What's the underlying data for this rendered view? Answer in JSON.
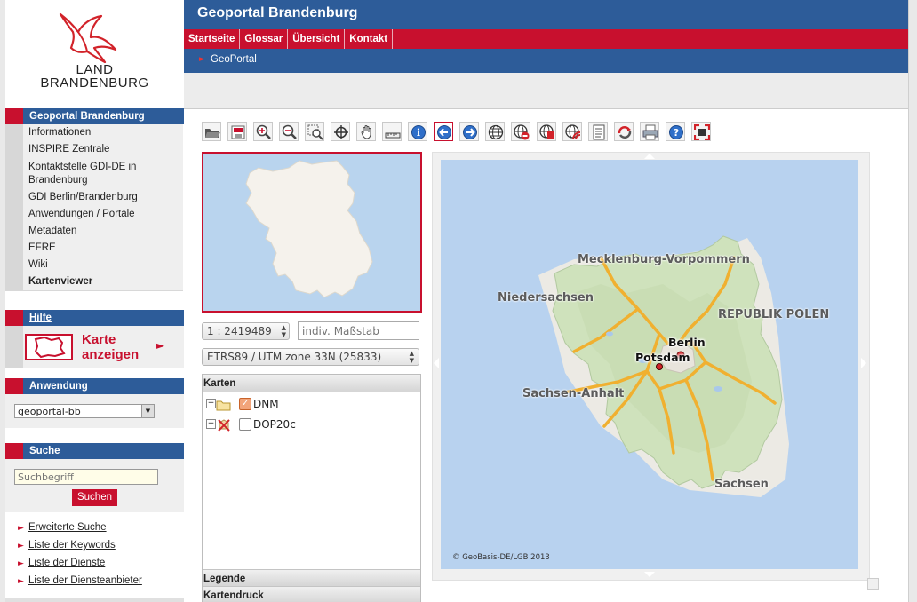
{
  "logo": {
    "line1": "LAND",
    "line2": "BRANDENBURG"
  },
  "header": {
    "title": "Geoportal Brandenburg"
  },
  "topnav": [
    "Startseite",
    "Glossar",
    "Übersicht",
    "Kontakt"
  ],
  "breadcrumb": "GeoPortal",
  "sidebar": {
    "section_title": "Geoportal Brandenburg",
    "items": [
      {
        "label": "Informationen"
      },
      {
        "label": "INSPIRE Zentrale"
      },
      {
        "label": "Kontaktstelle GDI-DE in Brandenburg"
      },
      {
        "label": "GDI Berlin/Brandenburg"
      },
      {
        "label": "Anwendungen / Portale"
      },
      {
        "label": "Metadaten"
      },
      {
        "label": "EFRE"
      },
      {
        "label": "Wiki"
      },
      {
        "label": "Kartenviewer"
      }
    ],
    "help_title": "Hilfe",
    "show_map_line1": "Karte",
    "show_map_line2": "anzeigen",
    "app_title": "Anwendung",
    "app_select": "geoportal-bb",
    "search_title": "Suche",
    "search_placeholder": "Suchbegriff",
    "search_button": "Suchen",
    "links": [
      "Erweiterte Suche",
      "Liste der Keywords",
      "Liste der Dienste",
      "Liste der Diensteanbieter"
    ]
  },
  "toolbar_icons": [
    "open-folder-icon",
    "save-icon",
    "zoom-in-icon",
    "zoom-out-icon",
    "zoom-box-icon",
    "center-icon",
    "pan-hand-icon",
    "measure-icon",
    "info-icon",
    "back-icon",
    "forward-icon",
    "globe-icon",
    "globe-remove-icon",
    "globe-add-icon",
    "globe-feed-icon",
    "layer-list-icon",
    "refresh-icon",
    "print-icon",
    "help-icon",
    "fullscreen-icon"
  ],
  "scale": {
    "value": "1 : 2419489",
    "custom_placeholder": "indiv. Maßstab"
  },
  "crs": "ETRS89 / UTM zone 33N (25833)",
  "layers": {
    "title": "Karten",
    "items": [
      {
        "name": "DNM",
        "checked": true
      },
      {
        "name": "DOP20c",
        "checked": false
      }
    ]
  },
  "panels": {
    "legend": "Legende",
    "print": "Kartendruck"
  },
  "map": {
    "labels": [
      "Mecklenburg-Vorpommern",
      "Niedersachsen",
      "REPUBLIK POLEN",
      "Sachsen-Anhalt",
      "Sachsen"
    ],
    "cities": [
      "Berlin",
      "Potsdam"
    ],
    "copyright": "© GeoBasis-DE/LGB 2013"
  },
  "colors": {
    "brand_blue": "#2d5c99",
    "brand_red": "#c8102e",
    "water": "#b8d2ef"
  }
}
